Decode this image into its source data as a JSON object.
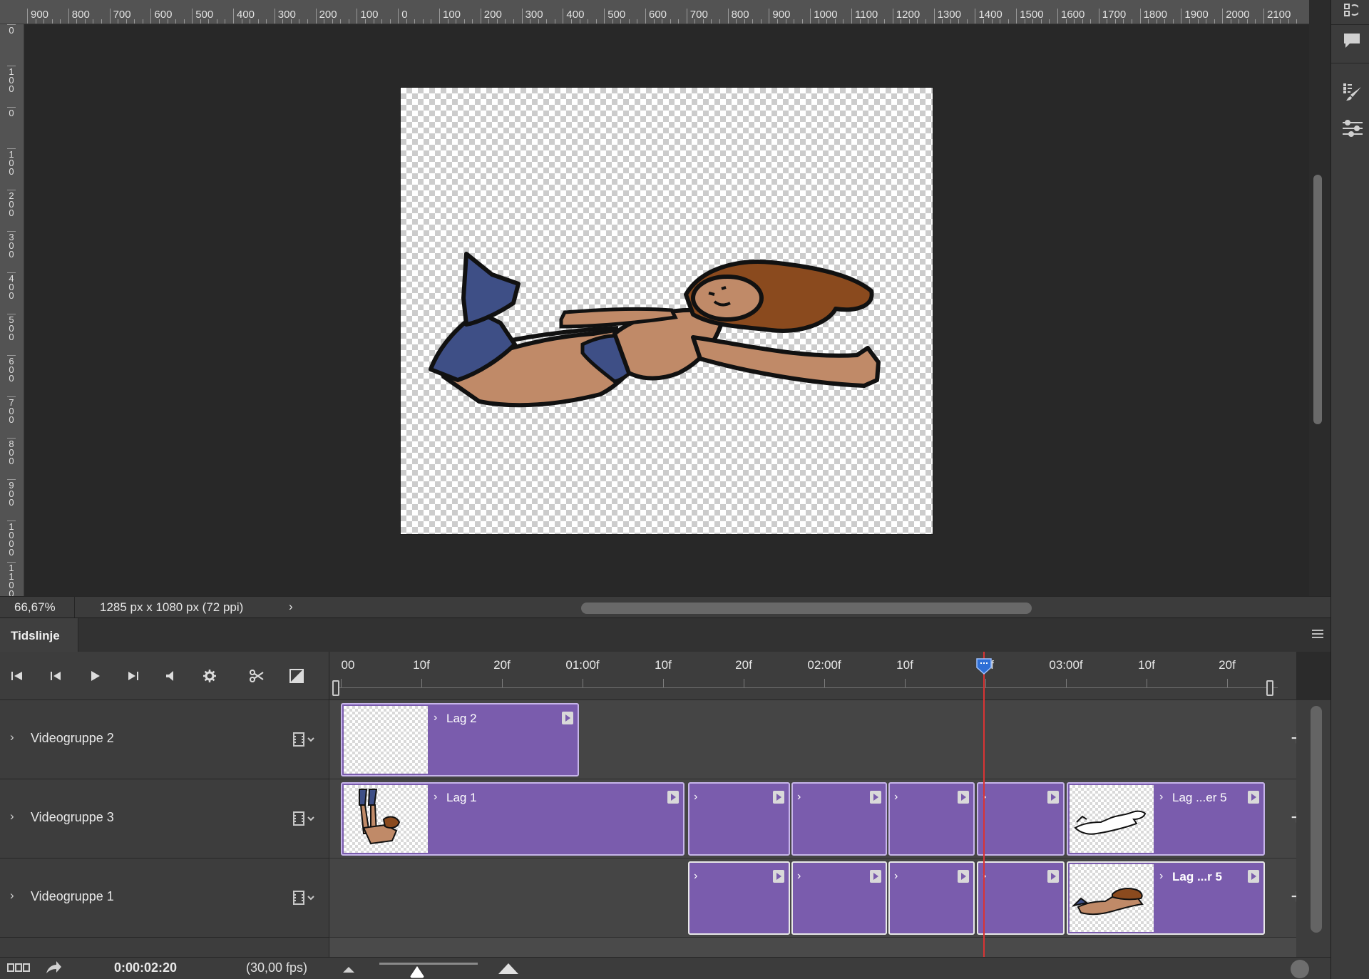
{
  "ruler_top": {
    "labels": [
      "900",
      "800",
      "700",
      "600",
      "500",
      "400",
      "300",
      "200",
      "100",
      "0",
      "100",
      "200",
      "300",
      "400",
      "500",
      "600",
      "700",
      "800",
      "900",
      "1000",
      "1100",
      "1200",
      "1300",
      "1400",
      "1500",
      "1600",
      "1700",
      "1800",
      "1900",
      "2000",
      "2100"
    ]
  },
  "ruler_left": {
    "labels": [
      "0",
      "100",
      "0",
      "100",
      "200",
      "300",
      "400",
      "500",
      "600",
      "700",
      "800",
      "900",
      "1000",
      "1100"
    ]
  },
  "status": {
    "zoom": "66,67%",
    "doc_info": "1285 px x 1080 px (72 ppi)",
    "arrow": "›"
  },
  "timeline": {
    "tab_label": "Tidslinje",
    "ruler_labels": [
      "00",
      "10f",
      "20f",
      "01:00f",
      "10f",
      "20f",
      "02:00f",
      "10f",
      "20f",
      "03:00f",
      "10f",
      "20f"
    ],
    "playhead_label": "20f",
    "tracks": [
      {
        "name": "Videogruppe 2",
        "clips": [
          {
            "label": "Lag 2",
            "thumb": "empty"
          }
        ]
      },
      {
        "name": "Videogruppe 3",
        "clips": [
          {
            "label": "Lag 1",
            "thumb": "figure-vertical"
          },
          {
            "label": ""
          },
          {
            "label": ""
          },
          {
            "label": ""
          },
          {
            "label": ""
          },
          {
            "label": "Lag ...er 5",
            "thumb": "figure-outline"
          }
        ]
      },
      {
        "name": "Videogruppe 1",
        "clips": [
          {
            "label": ""
          },
          {
            "label": ""
          },
          {
            "label": ""
          },
          {
            "label": ""
          },
          {
            "label": "Lag ...r 5",
            "thumb": "figure-color"
          }
        ]
      }
    ]
  },
  "bottom": {
    "current_time": "0:00:02:20",
    "fps": "(30,00 fps)"
  },
  "colors": {
    "clip_purple": "#7a5cad",
    "playhead_red": "#d93434",
    "playhead_blue": "#2f6fd6"
  }
}
